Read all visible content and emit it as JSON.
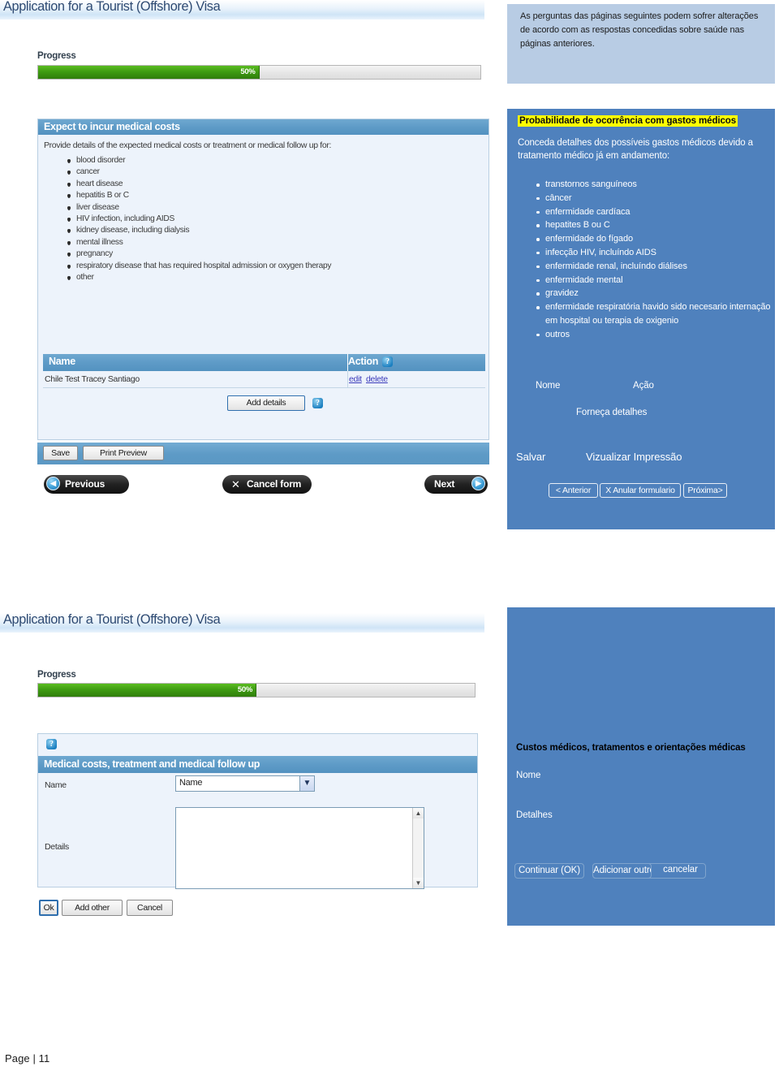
{
  "document": {
    "footer": "Page | 11"
  },
  "tip": {
    "text": "As perguntas das páginas seguintes podem sofrer alterações  de acordo com as respostas concedidas sobre saúde nas páginas anteriores."
  },
  "section1": {
    "app_title": "Application for a Tourist (Offshore) Visa",
    "progress": {
      "label": "Progress",
      "percent_label": "50%",
      "percent": 50
    },
    "panel": {
      "header": "Expect to incur medical costs",
      "intro": "Provide details of the expected medical costs or treatment or medical follow up for:",
      "items": [
        "blood disorder",
        "cancer",
        "heart disease",
        "hepatitis B or C",
        "liver disease",
        "HIV infection, including AIDS",
        "kidney disease,  including dialysis",
        "mental illness",
        "pregnancy",
        "respiratory disease  that has required hospital admission or oxygen therapy",
        "other"
      ]
    },
    "table": {
      "col_name": "Name",
      "col_action": "Action",
      "action_help_icon": "help-icon",
      "rows": [
        {
          "name": "Chile Test Tracey Santiago",
          "edit": "edit",
          "delete": "delete"
        }
      ],
      "add_details_button": "Add details",
      "add_details_help_icon": "help-icon"
    },
    "toolbar": {
      "save": "Save",
      "print_preview": "Print Preview"
    },
    "nav": {
      "previous": "Previous",
      "cancel_form": "Cancel form",
      "next": "Next",
      "previous_icon": "chevron-left-icon",
      "cancel_icon": "close-x-icon",
      "next_icon": "chevron-right-icon"
    }
  },
  "section1_translation": {
    "title": "Probabilidade de ocorrência com gastos médicos",
    "intro": "Conceda detalhes dos possíveis gastos médicos devido a tratamento médico já em andamento:",
    "items": [
      "transtornos sanguíneos",
      "câncer",
      "enfermidade cardíaca",
      "hepatites B ou C",
      "enfermidade do fígado",
      "infecção HIV, incluíndo AIDS",
      "enfermidade renal, incluíndo diálises",
      "enfermidade mental",
      "gravidez",
      "enfermidade respiratória havido sido necesario internação em hospital ou terapia de oxigenio",
      "outros"
    ],
    "col_name": "Nome",
    "col_action": "Ação",
    "add_details": "Forneça detalhes",
    "save": "Salvar",
    "print_preview": "Vizualizar Impressão",
    "buttons": [
      "< Anterior",
      "X Anular formulario",
      "Próxima>"
    ]
  },
  "section2": {
    "app_title": "Application for a Tourist (Offshore) Visa",
    "progress": {
      "label": "Progress",
      "percent_label": "50%",
      "percent": 50
    },
    "panel": {
      "help_icon": "help-icon",
      "header": "Medical costs, treatment and medical follow up",
      "name_label": "Name",
      "name_select_value": "Name",
      "name_select_icon": "chevron-down-icon",
      "details_label": "Details",
      "details_value": "",
      "scroll_up_icon": "caret-up-icon",
      "scroll_down_icon": "caret-down-icon"
    },
    "buttons": {
      "ok": "Ok",
      "add_other": "Add other",
      "cancel": "Cancel"
    }
  },
  "section2_translation": {
    "title": "Custos médicos, tratamentos e orientações médicas",
    "name_label": "Nome",
    "details_label": "Detalhes",
    "buttons": [
      "Continuar (OK)",
      "Adicionar outro",
      "cancelar"
    ]
  },
  "colors": {
    "panel_header_blue": "#5e9bc7",
    "translation_blue": "#4f81bd",
    "tip_blue": "#b8cce4",
    "highlight_yellow": "#ffff00",
    "progress_green": "#3f9c12",
    "link_blue": "#3b3bbb"
  }
}
